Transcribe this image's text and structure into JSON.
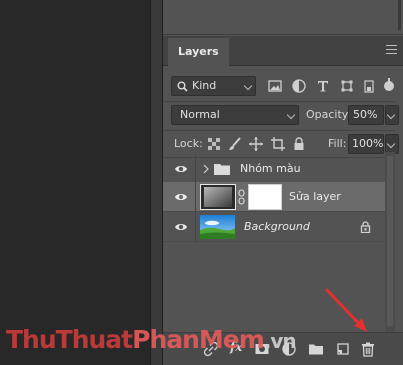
{
  "panel": {
    "tab_label": "Layers",
    "filter_kind": "Kind",
    "blend_mode": "Normal",
    "opacity_label": "Opacity:",
    "opacity_value": "50%",
    "lock_label": "Lock:",
    "fill_label": "Fill:",
    "fill_value": "100%"
  },
  "layers": [
    {
      "name": "Nhóm màu",
      "type": "group",
      "selected": false
    },
    {
      "name": "Sửa layer",
      "type": "masked",
      "selected": true
    },
    {
      "name": "Background",
      "type": "background",
      "selected": false,
      "locked": true
    }
  ],
  "bottom_bar": {
    "fx_label": "fx",
    "icons": [
      "link-icon",
      "fx-icon",
      "mask-icon",
      "adjustment-icon",
      "folder-icon",
      "new-layer-icon",
      "trash-icon"
    ]
  },
  "watermark": {
    "part1": "ThuThuat",
    "part2": "PhanMem",
    "part3": ".vn"
  },
  "colors": {
    "panel_bg": "#535353",
    "selected_layer": "#6b6b6b",
    "annotation_arrow": "#e2312e"
  }
}
